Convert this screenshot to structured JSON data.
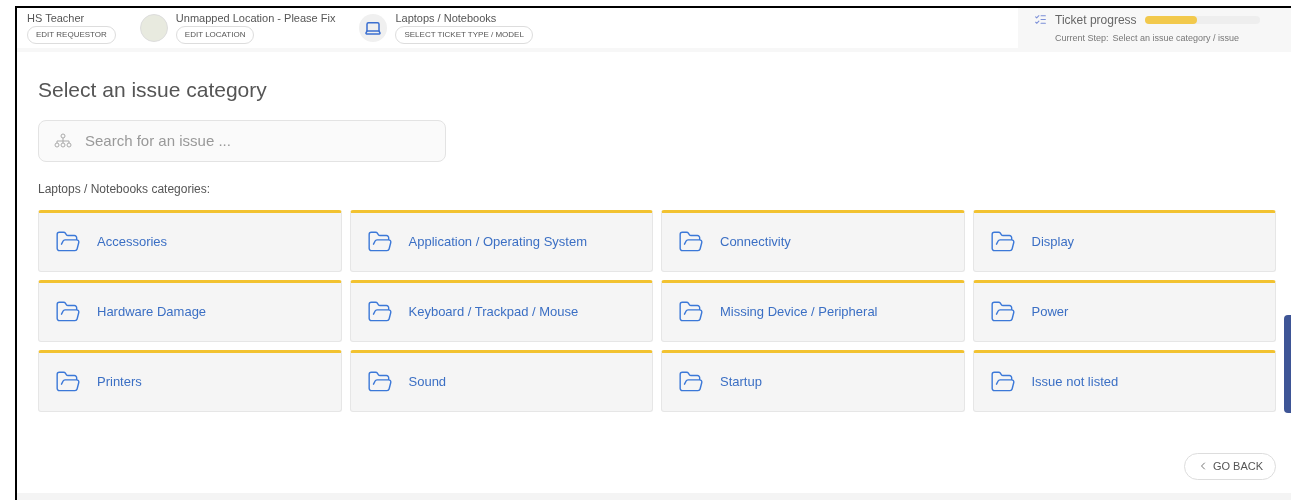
{
  "breadcrumb": [
    {
      "kind": "person",
      "title": "HS Teacher",
      "action": "EDIT REQUESTOR"
    },
    {
      "kind": "map",
      "title": "Unmapped Location - Please Fix",
      "action": "EDIT LOCATION"
    },
    {
      "kind": "laptop",
      "title": "Laptops / Notebooks",
      "action": "SELECT TICKET TYPE / MODEL"
    }
  ],
  "progress": {
    "title": "Ticket progress",
    "level": 0.46,
    "step_label": "Current Step:",
    "step": "Select an issue category / issue"
  },
  "heading": "Select an issue category",
  "search": {
    "placeholder": "Search for an issue ..."
  },
  "categories_label": "Laptops / Notebooks categories:",
  "categories": [
    "Accessories",
    "Application / Operating System",
    "Connectivity",
    "Display",
    "Hardware Damage",
    "Keyboard / Trackpad / Mouse",
    "Missing Device / Peripheral",
    "Power",
    "Printers",
    "Sound",
    "Startup",
    "Issue not listed"
  ],
  "back_button": "GO BACK"
}
